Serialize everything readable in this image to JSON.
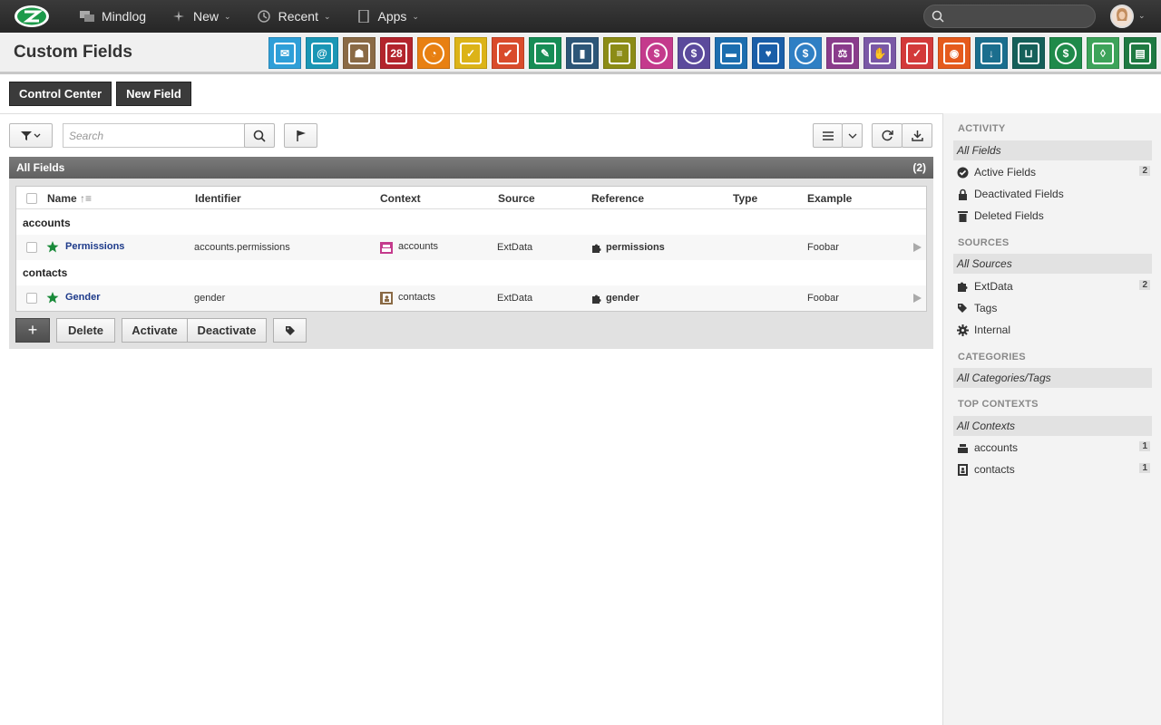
{
  "topbar": {
    "brand": "Mindlog",
    "new_label": "New",
    "recent_label": "Recent",
    "apps_label": "Apps",
    "search_placeholder": ""
  },
  "header": {
    "title": "Custom Fields",
    "app_icons": [
      {
        "name": "mail-app-icon",
        "color": "#2f9fd8",
        "glyph": "✉"
      },
      {
        "name": "address-app-icon",
        "color": "#1a96b5",
        "glyph": "@"
      },
      {
        "name": "contacts-app-icon",
        "color": "#8a6a45",
        "glyph": "☗"
      },
      {
        "name": "calendar-app-icon",
        "color": "#b3242c",
        "glyph": "28"
      },
      {
        "name": "timer-app-icon",
        "color": "#e88012",
        "glyph": "◔"
      },
      {
        "name": "tasks-app-icon",
        "color": "#dcb318",
        "glyph": "✓"
      },
      {
        "name": "projects-app-icon",
        "color": "#d94b2b",
        "glyph": "✔"
      },
      {
        "name": "notes-app-icon",
        "color": "#178d56",
        "glyph": "✎"
      },
      {
        "name": "bookmarks-app-icon",
        "color": "#2d5678",
        "glyph": "▮"
      },
      {
        "name": "documents-app-icon",
        "color": "#8c8c16",
        "glyph": "≡"
      },
      {
        "name": "accounts-app-icon",
        "color": "#c43a8c",
        "glyph": "$"
      },
      {
        "name": "billing-app-icon",
        "color": "#5b4a9c",
        "glyph": "$"
      },
      {
        "name": "shipping-app-icon",
        "color": "#1c6eaf",
        "glyph": "▬"
      },
      {
        "name": "support-app-icon",
        "color": "#1a5ea8",
        "glyph": "♥"
      },
      {
        "name": "expenses-app-icon",
        "color": "#2f7fc4",
        "glyph": "$"
      },
      {
        "name": "legal-app-icon",
        "color": "#8a3c8c",
        "glyph": "⚖"
      },
      {
        "name": "deals-app-icon",
        "color": "#7a58a6",
        "glyph": "✋"
      },
      {
        "name": "pdf-app-icon",
        "color": "#d33a3a",
        "glyph": "✓"
      },
      {
        "name": "broadcast-app-icon",
        "color": "#e55a1c",
        "glyph": "◉"
      },
      {
        "name": "downloads-app-icon",
        "color": "#1b6e8e",
        "glyph": "↓"
      },
      {
        "name": "cart-app-icon",
        "color": "#16605a",
        "glyph": "⊔"
      },
      {
        "name": "finance-app-icon",
        "color": "#1f8a4a",
        "glyph": "$"
      },
      {
        "name": "pricing-app-icon",
        "color": "#3da35a",
        "glyph": "◊"
      },
      {
        "name": "database-app-icon",
        "color": "#1f7a42",
        "glyph": "▤"
      }
    ]
  },
  "actions": {
    "control_center": "Control Center",
    "new_field": "New Field"
  },
  "toolbar": {
    "search_placeholder": "Search"
  },
  "panel": {
    "title": "All Fields",
    "count": "(2)",
    "columns": [
      "Name",
      "Identifier",
      "Context",
      "Source",
      "Reference",
      "Type",
      "Example"
    ],
    "groups": [
      {
        "label": "accounts",
        "row": {
          "name": "Permissions",
          "identifier": "accounts.permissions",
          "context": "accounts",
          "source": "ExtData",
          "reference": "permissions",
          "type": "",
          "example": "Foobar"
        }
      },
      {
        "label": "contacts",
        "row": {
          "name": "Gender",
          "identifier": "gender",
          "context": "contacts",
          "source": "ExtData",
          "reference": "gender",
          "type": "",
          "example": "Foobar"
        }
      }
    ],
    "buttons": {
      "add": "+",
      "delete": "Delete",
      "activate": "Activate",
      "deactivate": "Deactivate"
    }
  },
  "sidebar": {
    "activity_heading": "ACTIVITY",
    "activity_all": "All Fields",
    "activity_items": [
      {
        "label": "Active Fields",
        "count": "2"
      },
      {
        "label": "Deactivated Fields",
        "count": ""
      },
      {
        "label": "Deleted Fields",
        "count": ""
      }
    ],
    "sources_heading": "SOURCES",
    "sources_all": "All Sources",
    "sources_items": [
      {
        "label": "ExtData",
        "count": "2"
      },
      {
        "label": "Tags",
        "count": ""
      },
      {
        "label": "Internal",
        "count": ""
      }
    ],
    "categories_heading": "CATEGORIES",
    "categories_all": "All Categories/Tags",
    "contexts_heading": "TOP CONTEXTS",
    "contexts_all": "All Contexts",
    "contexts_items": [
      {
        "label": "accounts",
        "count": "1"
      },
      {
        "label": "contacts",
        "count": "1"
      }
    ]
  }
}
